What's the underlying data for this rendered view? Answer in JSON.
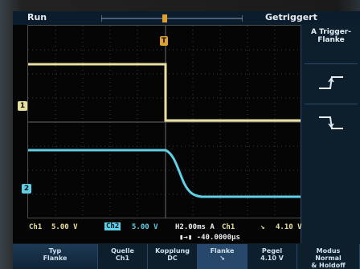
{
  "header": {
    "run_label": "Run",
    "trigger_status": "Getriggert"
  },
  "markers": {
    "ch1": "1",
    "ch2": "2",
    "trigger": "T"
  },
  "side_menu": {
    "title_line1": "A Trigger-",
    "title_line2": "Flanke",
    "options": [
      {
        "icon": "rising-edge-icon"
      },
      {
        "icon": "falling-edge-icon"
      }
    ],
    "selected_index": 1
  },
  "readout": {
    "ch1_label": "Ch1",
    "ch1_scale": "5.00 V",
    "ch2_label": "Ch2",
    "ch2_scale": "5.00 V",
    "timebase": "H2.00ms A",
    "trigger_source": "Ch1",
    "trigger_slope": "↘",
    "trigger_level": "4.10 V",
    "position": "▮→▮ -40.0000μs"
  },
  "bottom_menu": [
    {
      "line1": "Typ",
      "line2": "Flanke"
    },
    {
      "line1": "Quelle",
      "line2": "Ch1"
    },
    {
      "line1": "Kopplung",
      "line2": "DC"
    },
    {
      "line1": "Flanke",
      "line2": "↘"
    },
    {
      "line1": "Pegel",
      "line2": "4.10 V"
    },
    {
      "line1": "Modus",
      "line2": "Normal",
      "line3": "& Holdoff"
    }
  ],
  "colors": {
    "ch1": "#e8e0a0",
    "ch2": "#5fd0e6",
    "trigger": "#e0a030",
    "menu_bg": "#0d1e2d"
  }
}
